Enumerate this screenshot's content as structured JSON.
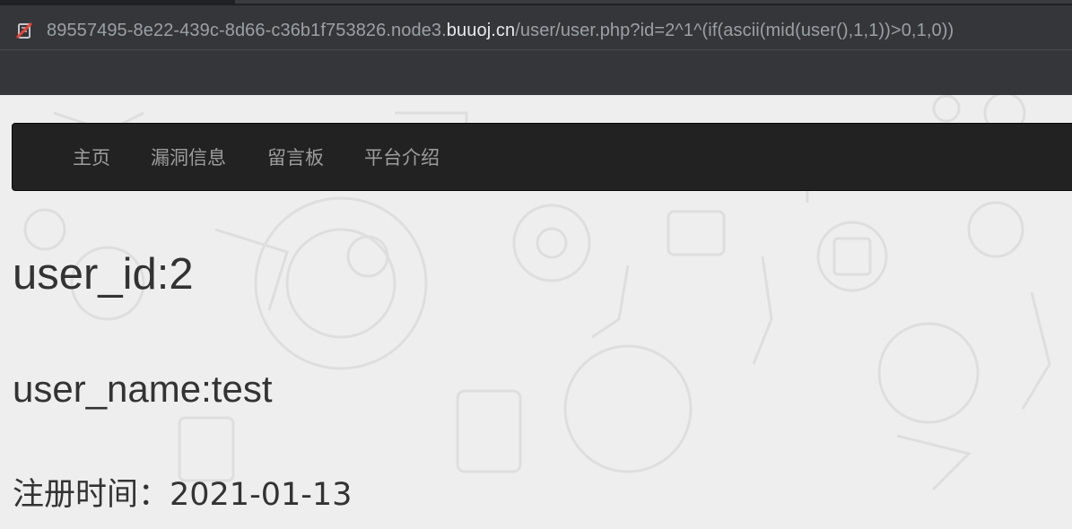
{
  "browser": {
    "url": {
      "prefix": "89557495-8e22-439c-8d66-c36b1f753826.node3.",
      "domain": "buuoj.cn",
      "path": "/user/user.php?id=2^1^(if(ascii(mid(user(),1,1))>0,1,0))"
    },
    "security_icon": "not-secure-icon"
  },
  "navbar": {
    "items": [
      {
        "label": "主页"
      },
      {
        "label": "漏洞信息"
      },
      {
        "label": "留言板"
      },
      {
        "label": "平台介绍"
      }
    ]
  },
  "profile": {
    "user_id": "user_id:2",
    "user_name": "user_name:test",
    "register_time": "注册时间：2021-01-13"
  },
  "colors": {
    "navbar_bg": "#222222",
    "nav_text": "#9d9d9d",
    "body_text": "#333333",
    "page_bg": "#eeeeee"
  }
}
